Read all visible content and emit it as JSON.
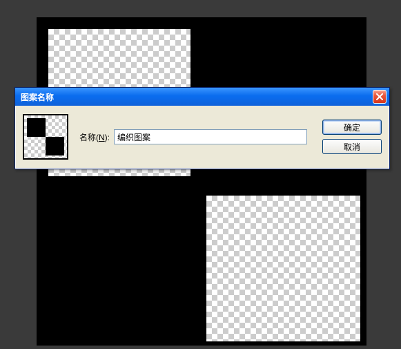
{
  "dialog": {
    "title": "图案名称",
    "name_label_prefix": "名称(",
    "name_label_key": "N",
    "name_label_suffix": "):",
    "name_value": "编织图案",
    "ok_label": "确定",
    "cancel_label": "取消"
  }
}
